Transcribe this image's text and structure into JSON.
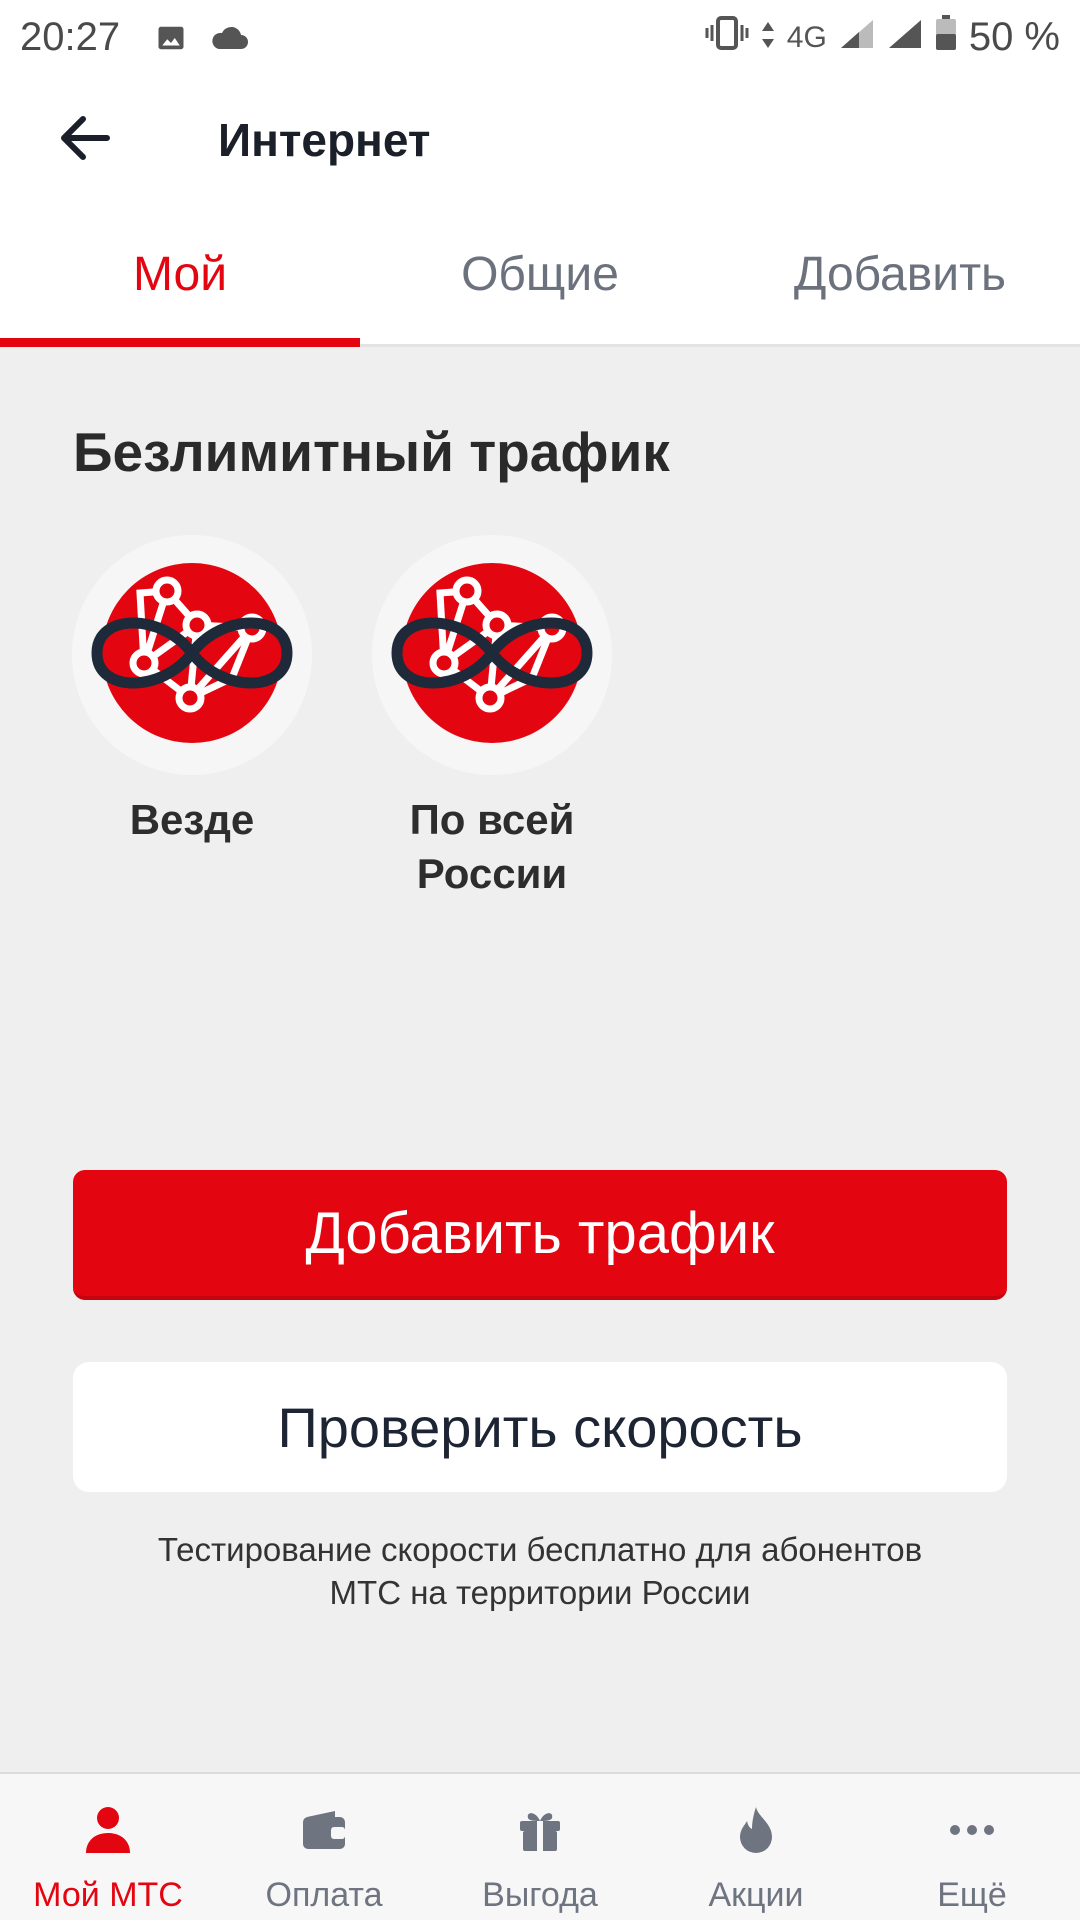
{
  "status_bar": {
    "time": "20:27",
    "network": "4G",
    "battery": "50 %"
  },
  "app_bar": {
    "title": "Интернет"
  },
  "tabs": [
    {
      "label": "Мой",
      "active": true
    },
    {
      "label": "Общие",
      "active": false
    },
    {
      "label": "Добавить",
      "active": false
    }
  ],
  "main": {
    "section_title": "Безлимитный трафик",
    "options": [
      {
        "label": "Везде",
        "icon": "globe-infinity-icon"
      },
      {
        "label": "По всей России",
        "icon": "globe-infinity-icon"
      }
    ],
    "add_traffic_label": "Добавить трафик",
    "check_speed_label": "Проверить скорость",
    "note": "Тестирование скорости бесплатно для абонентов МТС на территории России"
  },
  "bottom_nav": [
    {
      "label": "Мой МТС",
      "icon": "user-icon",
      "active": true
    },
    {
      "label": "Оплата",
      "icon": "wallet-icon",
      "active": false
    },
    {
      "label": "Выгода",
      "icon": "gift-icon",
      "active": false
    },
    {
      "label": "Акции",
      "icon": "flame-icon",
      "active": false
    },
    {
      "label": "Ещё",
      "icon": "more-icon",
      "active": false
    }
  ],
  "colors": {
    "accent": "#e30611",
    "icon_ring": "#1e2a3a",
    "nav_inactive": "#6e7480"
  }
}
